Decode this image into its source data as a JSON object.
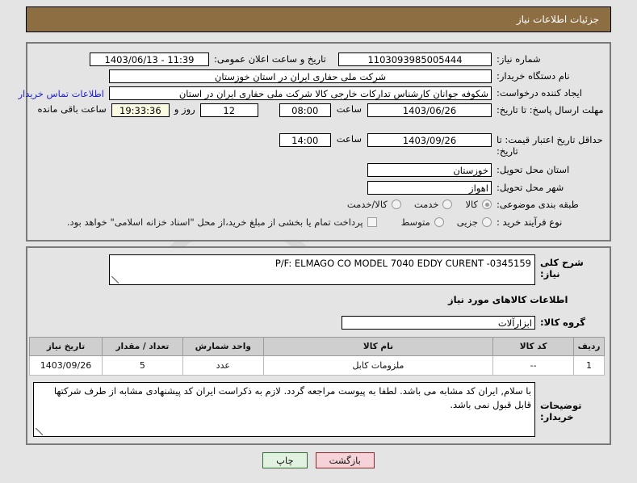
{
  "header": {
    "title": "جزئیات اطلاعات نیاز"
  },
  "watermark": {
    "text": "AriaTender",
    "suffix": ".net"
  },
  "top_form": {
    "need_number": {
      "label": "شماره نیاز:",
      "value": "1103093985005444"
    },
    "announce_datetime": {
      "label": "تاریخ و ساعت اعلان عمومی:",
      "value": "11:39 - 1403/06/13"
    },
    "buyer_org": {
      "label": "نام دستگاه خریدار:",
      "value": "شرکت ملی حفاری ایران در استان خوزستان"
    },
    "requester": {
      "label": "ایجاد کننده درخواست:",
      "value": "شکوفه جوانان کارشناس تدارکات خارجی کالا شرکت ملی حفاری ایران در استان",
      "contact_link": "اطلاعات تماس خریدار"
    },
    "response_deadline": {
      "label": "مهلت ارسال پاسخ: تا تاریخ:",
      "date": "1403/06/26",
      "hour_label": "ساعت",
      "hour": "08:00",
      "days": "12",
      "days_label": "روز و",
      "countdown": "19:33:36",
      "countdown_label": "ساعت باقی مانده"
    },
    "price_validity": {
      "label": "حداقل تاریخ اعتبار قیمت: تا تاریخ:",
      "date": "1403/09/26",
      "hour_label": "ساعت",
      "hour": "14:00"
    },
    "delivery_province": {
      "label": "استان محل تحویل:",
      "value": "خوزستان"
    },
    "delivery_city": {
      "label": "شهر محل تحویل:",
      "value": "اهواز"
    },
    "subject_category": {
      "label": "طبقه بندی موضوعی:",
      "options": [
        {
          "text": "کالا",
          "selected": true
        },
        {
          "text": "خدمت",
          "selected": false
        },
        {
          "text": "کالا/خدمت",
          "selected": false
        }
      ]
    },
    "purchase_type": {
      "label": "نوع فرآیند خرید :",
      "options": [
        {
          "text": "جزیی",
          "selected": false
        },
        {
          "text": "متوسط",
          "selected": false
        }
      ],
      "checkbox": {
        "checked": false,
        "text": "پرداخت تمام یا بخشی از مبلغ خرید،از محل \"اسناد خزانه اسلامی\" خواهد بود."
      }
    }
  },
  "main": {
    "summary": {
      "label": "شرح کلی نیاز:",
      "value": "P/F: ELMAGO CO MODEL 7040 EDDY CURENT -0345159"
    },
    "goods_section_title": "اطلاعات کالاهای مورد نیاز",
    "goods_group": {
      "label": "گروه کالا:",
      "value": "ابزارآلات"
    },
    "table": {
      "columns": [
        "ردیف",
        "کد کالا",
        "نام کالا",
        "واحد شمارش",
        "تعداد / مقدار",
        "تاریخ نیاز"
      ],
      "rows": [
        {
          "index": "1",
          "code": "--",
          "name": "ملزومات کابل",
          "unit": "عدد",
          "qty": "5",
          "date": "1403/09/26"
        }
      ]
    },
    "buyer_notes": {
      "label": "توضیحات خریدار:",
      "value": "با سلام, ایران کد مشابه می باشد. لطفا به پیوست مراجعه گردد. لازم به ذکراست ایران کد پیشنهادی مشابه از طرف شرکتها قابل قبول نمی باشد."
    }
  },
  "footer": {
    "back_button": "بازگشت",
    "print_button": "چاپ"
  },
  "colors": {
    "header_bg": "#8d6e43",
    "page_bg": "#e4e4e4",
    "link": "#2222cc",
    "back_btn_bg": "#f6d3d8",
    "print_btn_bg": "#e2f2e0"
  }
}
